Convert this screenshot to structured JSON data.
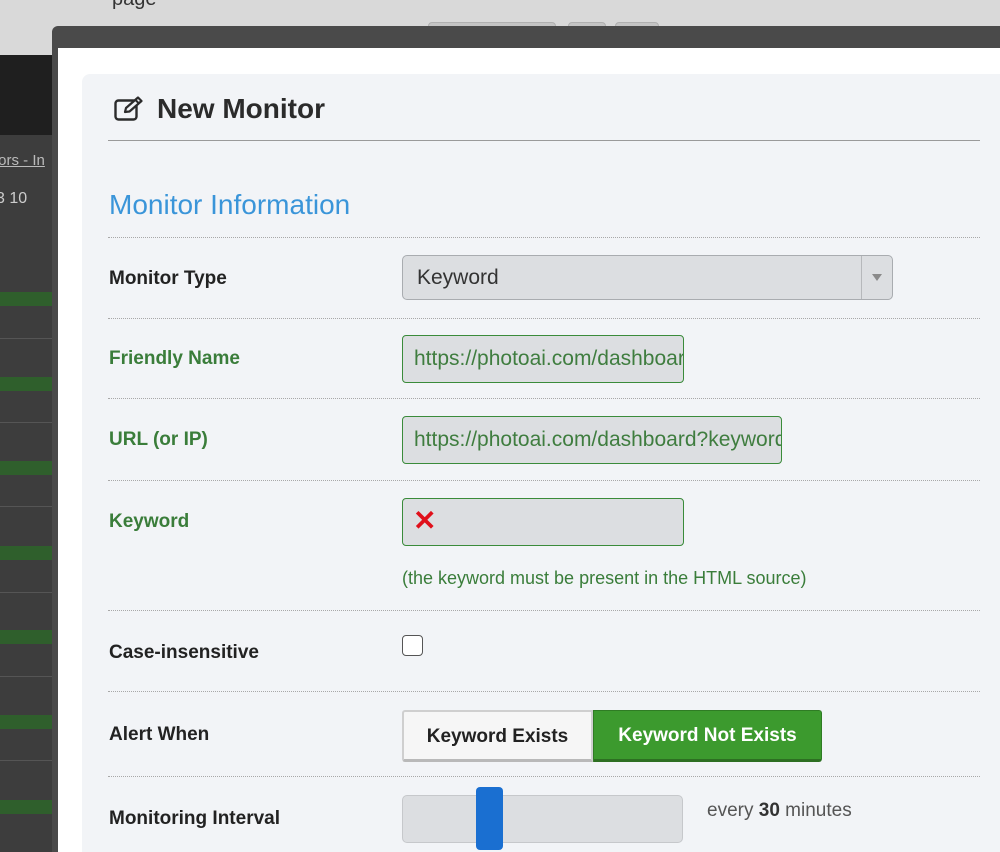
{
  "modal": {
    "title": "New Monitor",
    "section_title": "Monitor Information"
  },
  "background": {
    "top_text": "page",
    "link_text": "tors - In",
    "numbers": "3   10"
  },
  "fields": {
    "monitor_type": {
      "label": "Monitor Type",
      "value": "Keyword"
    },
    "friendly_name": {
      "label": "Friendly Name",
      "value": "https://photoai.com/dashboard"
    },
    "url": {
      "label": "URL (or IP)",
      "value": "https://photoai.com/dashboard?keyword"
    },
    "keyword": {
      "label": "Keyword",
      "value": "",
      "help": "(the keyword must be present in the HTML source)",
      "error_icon": "x-mark-icon"
    },
    "case_insensitive": {
      "label": "Case-insensitive",
      "checked": false
    },
    "alert_when": {
      "label": "Alert When",
      "options": [
        "Keyword Exists",
        "Keyword Not Exists"
      ],
      "selected": "Keyword Not Exists"
    },
    "monitoring_interval": {
      "label": "Monitoring Interval",
      "prefix": "every",
      "value": "30",
      "suffix": "minutes"
    }
  },
  "colors": {
    "section_blue": "#3a95d9",
    "valid_green": "#3a7d3a",
    "button_green": "#3c9a2e",
    "slider_blue": "#1a6fd1",
    "error_red": "#e0101b"
  }
}
